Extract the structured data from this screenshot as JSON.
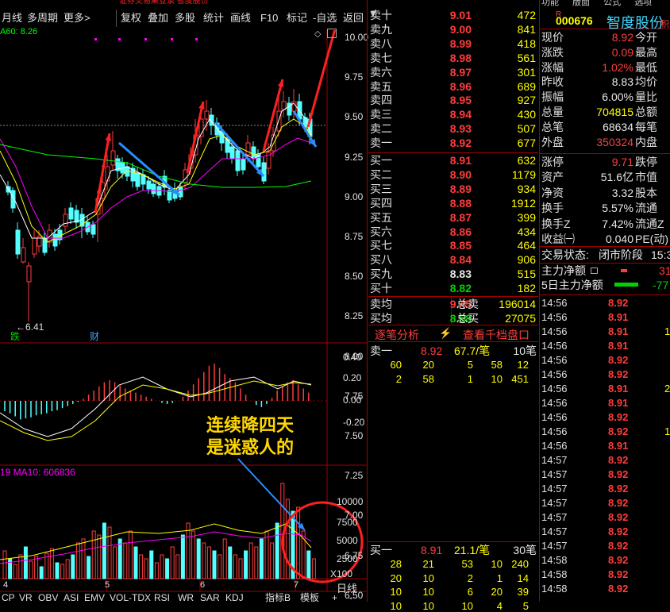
{
  "toolbar": {
    "left_items": [
      "月线",
      "多周期",
      "更多>"
    ],
    "right_items": [
      "复权",
      "叠加",
      "多股",
      "统计",
      "画线",
      "F10",
      "标记",
      "-自选",
      "返回"
    ]
  },
  "top_strip_text": "证券交易集登录  智度股份",
  "ma_legend": "A60: 8.26",
  "vol_legend": "19  MA10: 606836",
  "price_axis": [
    "10.00",
    "9.75",
    "9.50",
    "9.25",
    "9.00",
    "8.75",
    "8.50",
    "8.25",
    "8.00",
    "7.75",
    "7.50",
    "7.25",
    "7.00",
    "6.75",
    "6.50"
  ],
  "macd_axis": [
    "0.40",
    "0.20",
    "0.00",
    "-0.20"
  ],
  "vol_axis": [
    "10000",
    "7500",
    "5000",
    "2500",
    "X100"
  ],
  "low_marker": "6.41",
  "chart_badges": {
    "die": "跌",
    "cai": "财"
  },
  "date_labels": [
    "4",
    "5",
    "6",
    "7"
  ],
  "annotation": {
    "line1": "连续降四天",
    "line2": "是迷惑人的"
  },
  "bottom_tabs": [
    "CP",
    "VR",
    "OBV",
    "ASI",
    "EMV",
    "VOL-TDX",
    "RSI",
    "WR",
    "SAR",
    "KDJ",
    "",
    "指标B",
    "模板",
    "+",
    "-"
  ],
  "daily_label": "日线",
  "order_book": {
    "asks": [
      {
        "label": "卖十",
        "price": "9.01",
        "vol": "472"
      },
      {
        "label": "卖九",
        "price": "9.00",
        "vol": "841"
      },
      {
        "label": "卖八",
        "price": "8.99",
        "vol": "418"
      },
      {
        "label": "卖七",
        "price": "8.98",
        "vol": "561"
      },
      {
        "label": "卖六",
        "price": "8.97",
        "vol": "301"
      },
      {
        "label": "卖五",
        "price": "8.96",
        "vol": "689"
      },
      {
        "label": "卖四",
        "price": "8.95",
        "vol": "927"
      },
      {
        "label": "卖三",
        "price": "8.94",
        "vol": "430"
      },
      {
        "label": "卖二",
        "price": "8.93",
        "vol": "507"
      },
      {
        "label": "卖一",
        "price": "8.92",
        "vol": "677"
      }
    ],
    "bids": [
      {
        "label": "买一",
        "price": "8.91",
        "vol": "632"
      },
      {
        "label": "买二",
        "price": "8.90",
        "vol": "1179"
      },
      {
        "label": "买三",
        "price": "8.89",
        "vol": "934"
      },
      {
        "label": "买四",
        "price": "8.88",
        "vol": "1912"
      },
      {
        "label": "买五",
        "price": "8.87",
        "vol": "399"
      },
      {
        "label": "买六",
        "price": "8.86",
        "vol": "434"
      },
      {
        "label": "买七",
        "price": "8.85",
        "vol": "464"
      },
      {
        "label": "买八",
        "price": "8.84",
        "vol": "906"
      },
      {
        "label": "买九",
        "price": "8.83",
        "vol": "515"
      },
      {
        "label": "买十",
        "price": "8.82",
        "vol": "182"
      }
    ],
    "avg": [
      {
        "label": "卖均",
        "price": "9.45",
        "k": "总卖",
        "v": "196014"
      },
      {
        "label": "买均",
        "price": "8.68",
        "k": "总买",
        "v": "27075"
      }
    ]
  },
  "zhubi": {
    "tab1": "逐笔分析",
    "tab2": "查看千档盘口",
    "sell1": {
      "label": "卖一",
      "price": "8.92",
      "stat": "67.7/笔",
      "count": "10笔"
    },
    "sell_queue": [
      [
        "60",
        "20",
        "5",
        "58",
        "12"
      ],
      [
        "2",
        "58",
        "1",
        "10",
        "451"
      ]
    ],
    "buy1": {
      "label": "买一",
      "price": "8.91",
      "stat": "21.1/笔",
      "count": "30笔"
    },
    "buy_queue": [
      [
        "28",
        "21",
        "53",
        "10",
        "240"
      ],
      [
        "20",
        "10",
        "2",
        "1",
        "14"
      ],
      [
        "10",
        "10",
        "6",
        "20",
        "39"
      ],
      [
        "10",
        "10",
        "10",
        "4",
        "5"
      ]
    ]
  },
  "stock": {
    "code": "000676",
    "name": "智度股份",
    "flag": "R",
    "suffix": "积"
  },
  "top_menu": [
    "功能",
    "版面",
    "公式",
    "选项",
    "帮"
  ],
  "info": [
    {
      "k": "现价",
      "v": "8.92",
      "k2": "今开",
      "c": "red"
    },
    {
      "k": "涨跌",
      "v": "0.09",
      "k2": "最高",
      "c": "red"
    },
    {
      "k": "涨幅",
      "v": "1.02%",
      "k2": "最低",
      "c": "red"
    },
    {
      "k": "昨收",
      "v": "8.83",
      "k2": "均价",
      "c": "white"
    },
    {
      "k": "振幅",
      "v": "6.00%",
      "k2": "量比",
      "c": "white"
    },
    {
      "k": "总量",
      "v": "704815",
      "k2": "总额",
      "c": "yellow"
    },
    {
      "k": "总笔",
      "v": "68634",
      "k2": "每笔",
      "c": "white"
    },
    {
      "k": "外盘",
      "v": "350324",
      "k2": "内盘",
      "c": "red"
    },
    {
      "k": "涨停",
      "v": "9.71",
      "k2": "跌停",
      "c": "red"
    },
    {
      "k": "资产",
      "v": "51.6亿",
      "k2": "市值",
      "c": "white"
    },
    {
      "k": "净资",
      "v": "3.32",
      "k2": "股本",
      "c": "white"
    },
    {
      "k": "换手",
      "v": "5.57%",
      "k2": "流通",
      "c": "white"
    },
    {
      "k": "换手Z",
      "v": "7.42%",
      "k2": "流通Z",
      "c": "white"
    },
    {
      "k": "收益㈠",
      "v": "0.040",
      "k2": "PE(动)",
      "c": "white"
    }
  ],
  "trade_status": {
    "label": "交易状态:",
    "value": "闭市阶段",
    "time": "15:3"
  },
  "main_flow": [
    {
      "label": "主力净额",
      "value": "31",
      "c": "red"
    },
    {
      "label": "5日主力净额",
      "value": "-77",
      "c": "green"
    }
  ],
  "ticks": [
    {
      "t": "14:56",
      "p": "8.92",
      "c": "red",
      "q": ""
    },
    {
      "t": "14:56",
      "p": "8.91",
      "c": "red",
      "q": ""
    },
    {
      "t": "14:56",
      "p": "8.91",
      "c": "red",
      "q": "1"
    },
    {
      "t": "14:56",
      "p": "8.91",
      "c": "red",
      "q": ""
    },
    {
      "t": "14:56",
      "p": "8.92",
      "c": "red",
      "q": ""
    },
    {
      "t": "14:56",
      "p": "8.92",
      "c": "red",
      "q": ""
    },
    {
      "t": "14:56",
      "p": "8.91",
      "c": "red",
      "q": "2"
    },
    {
      "t": "14:56",
      "p": "8.91",
      "c": "red",
      "q": ""
    },
    {
      "t": "14:56",
      "p": "8.92",
      "c": "red",
      "q": ""
    },
    {
      "t": "14:56",
      "p": "8.92",
      "c": "red",
      "q": "1"
    },
    {
      "t": "14:56",
      "p": "8.91",
      "c": "red",
      "q": ""
    },
    {
      "t": "14:57",
      "p": "8.92",
      "c": "red",
      "q": ""
    },
    {
      "t": "14:57",
      "p": "8.92",
      "c": "red",
      "q": ""
    },
    {
      "t": "14:57",
      "p": "8.92",
      "c": "red",
      "q": ""
    },
    {
      "t": "14:57",
      "p": "8.92",
      "c": "red",
      "q": ""
    },
    {
      "t": "14:57",
      "p": "8.92",
      "c": "red",
      "q": ""
    },
    {
      "t": "14:57",
      "p": "8.92",
      "c": "red",
      "q": ""
    },
    {
      "t": "14:57",
      "p": "8.92",
      "c": "red",
      "q": ""
    },
    {
      "t": "14:58",
      "p": "8.92",
      "c": "red",
      "q": ""
    },
    {
      "t": "14:58",
      "p": "8.92",
      "c": "red",
      "q": ""
    },
    {
      "t": "14:58",
      "p": "8.92",
      "c": "red",
      "q": ""
    }
  ],
  "colors": {
    "up": "#ff3c3c",
    "down": "#54ffff",
    "ma_white": "#ffffff",
    "ma_yellow": "#ffff00",
    "ma_purple": "#ff00ff",
    "ma_green": "#00ff00",
    "arrow_red": "#ff2020",
    "arrow_blue": "#2a8cff",
    "circle": "#ff2020"
  }
}
